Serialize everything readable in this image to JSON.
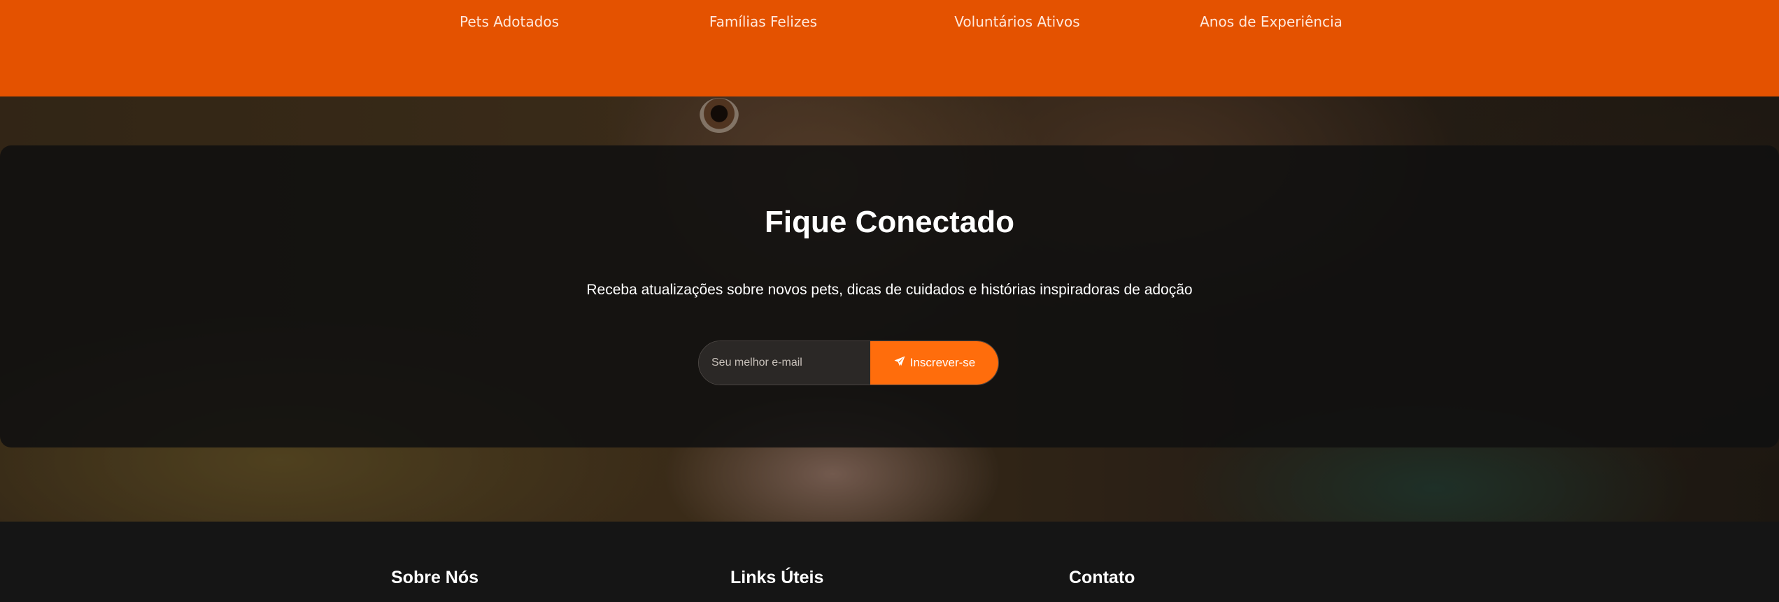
{
  "stats": {
    "items": [
      {
        "label": "Pets Adotados"
      },
      {
        "label": "Famílias Felizes"
      },
      {
        "label": "Voluntários Ativos"
      },
      {
        "label": "Anos de Experiência"
      }
    ]
  },
  "newsletter": {
    "title": "Fique Conectado",
    "description": "Receba atualizações sobre novos pets, dicas de cuidados e histórias inspiradoras de adoção",
    "email_placeholder": "Seu melhor e-mail",
    "subscribe_label": "Inscrever-se",
    "subscribe_icon": "paper-plane-icon"
  },
  "footer": {
    "columns": [
      {
        "heading": "Sobre Nós"
      },
      {
        "heading": "Links Úteis"
      },
      {
        "heading": "Contato"
      }
    ]
  },
  "colors": {
    "stats_bar": "#e45200",
    "accent": "#ff6d0c",
    "panel": "#101010",
    "footer": "#151515"
  }
}
